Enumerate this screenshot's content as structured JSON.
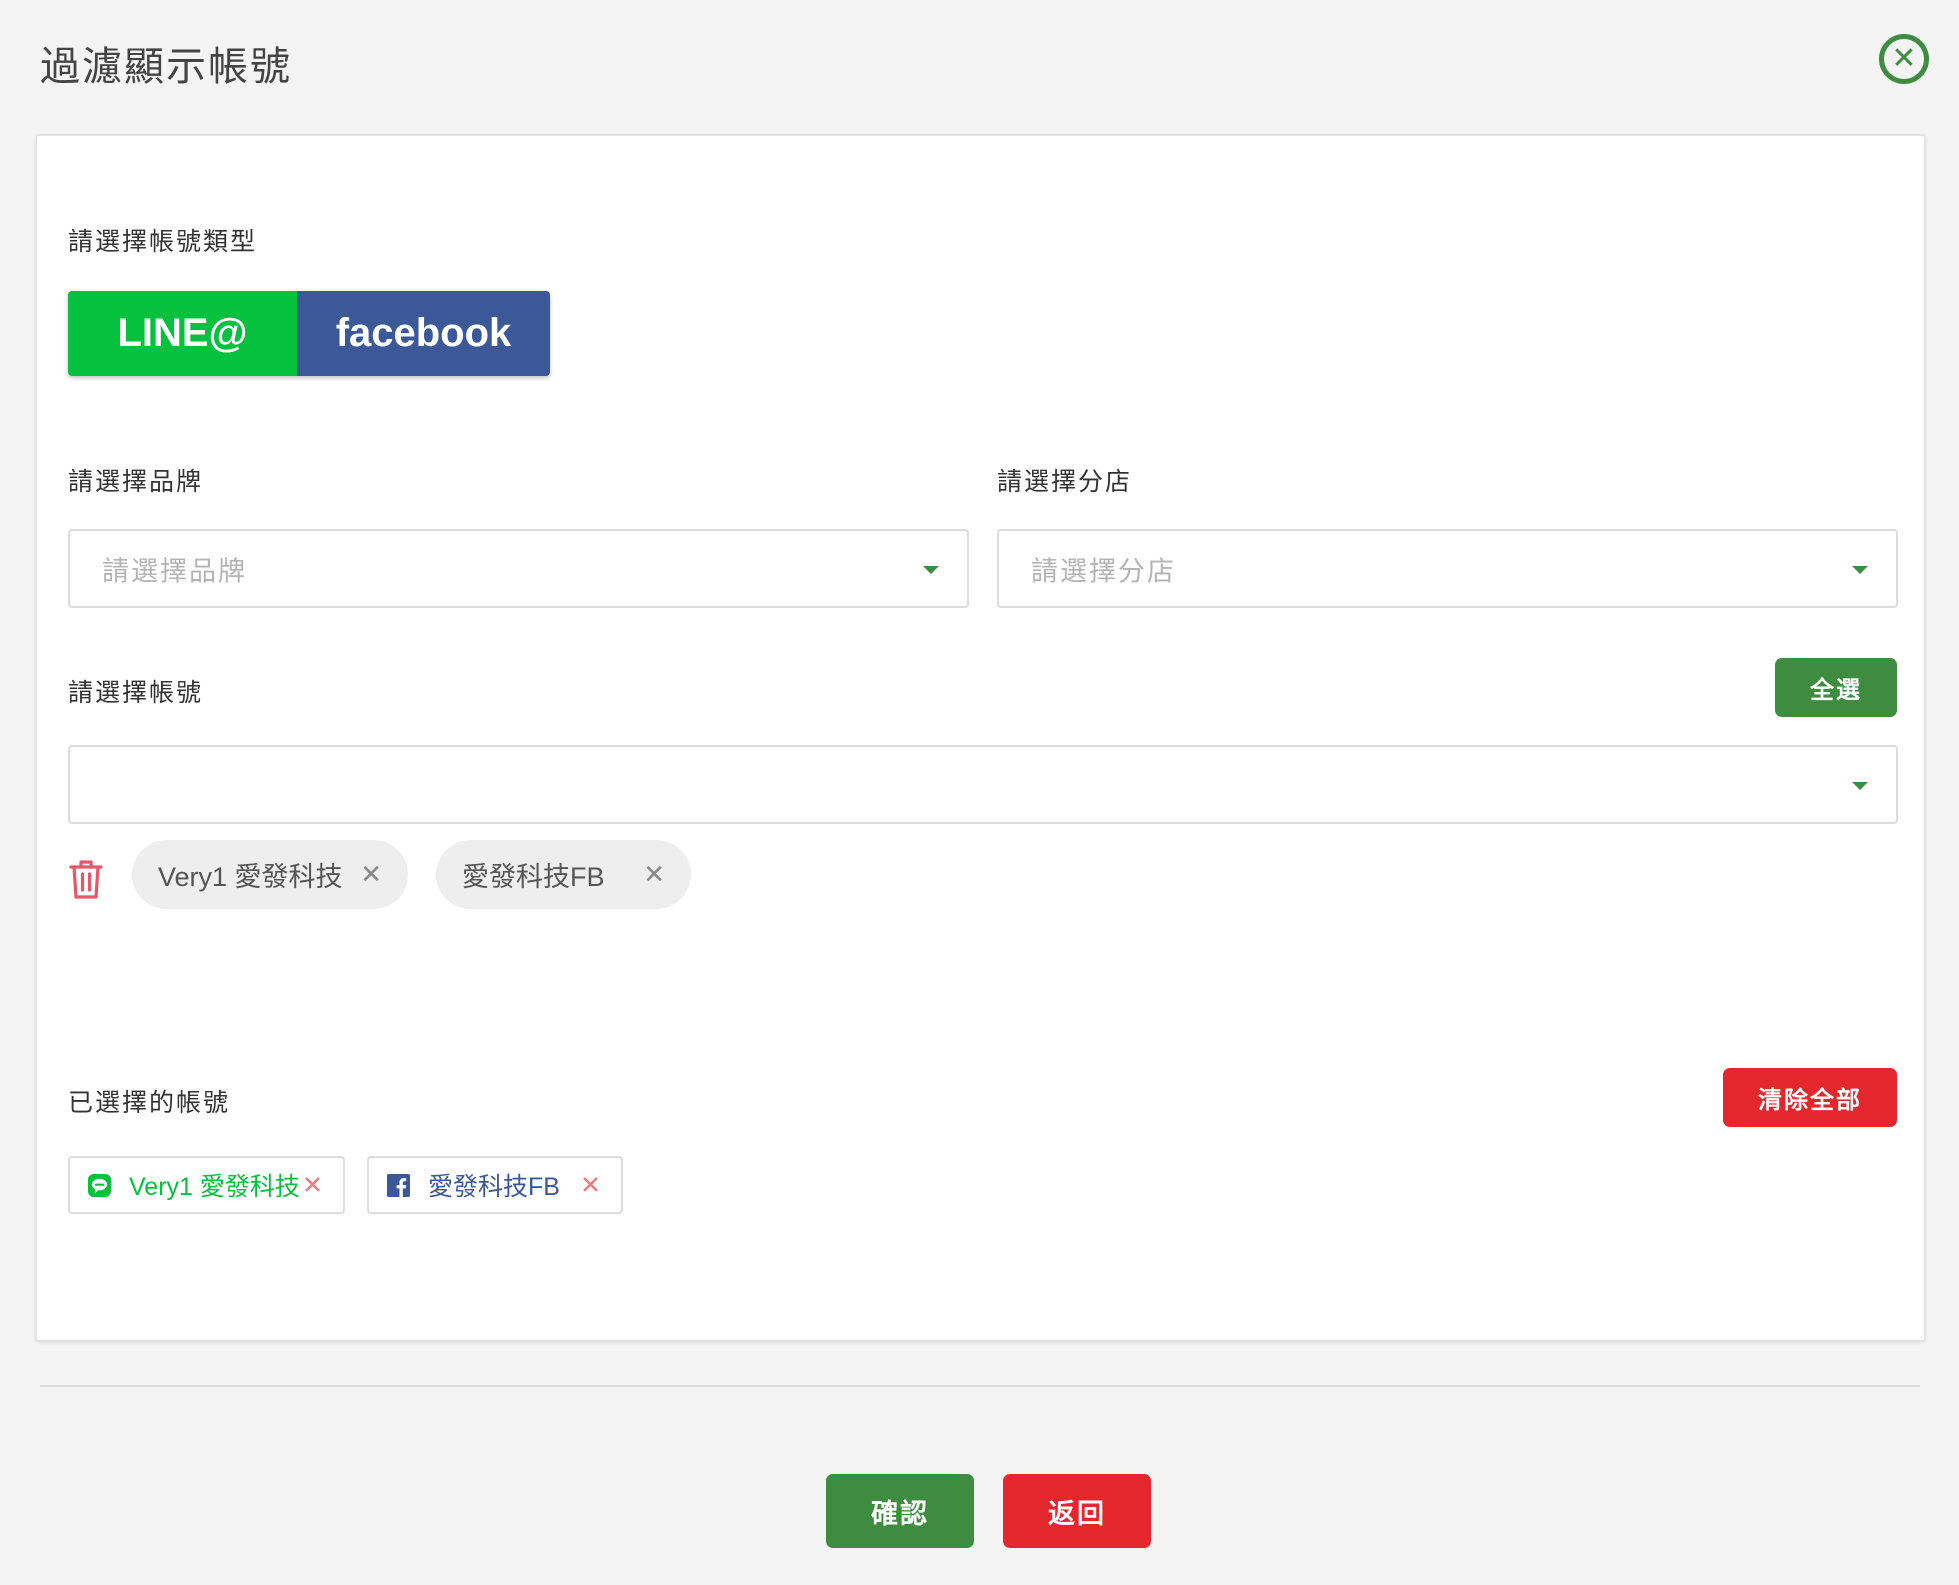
{
  "dialog": {
    "title": "過濾顯示帳號"
  },
  "account_type": {
    "label": "請選擇帳號類型",
    "line_label": "LINE@",
    "facebook_label": "facebook",
    "line_color": "#06c13e",
    "facebook_color": "#3b5998"
  },
  "brand": {
    "label": "請選擇品牌",
    "placeholder": "請選擇品牌",
    "value": ""
  },
  "branch": {
    "label": "請選擇分店",
    "placeholder": "請選擇分店",
    "value": ""
  },
  "accounts": {
    "label": "請選擇帳號",
    "select_all_label": "全選",
    "value": "",
    "chips": [
      {
        "label": "Very1 愛發科技"
      },
      {
        "label": "愛發科技FB"
      }
    ]
  },
  "selected": {
    "label": "已選擇的帳號",
    "clear_all_label": "清除全部",
    "items": [
      {
        "label": "Very1 愛發科技",
        "platform": "line",
        "icon": "line-icon",
        "color": "#06c13e"
      },
      {
        "label": "愛發科技FB",
        "platform": "facebook",
        "icon": "facebook-icon",
        "color": "#3b5998"
      }
    ]
  },
  "footer": {
    "confirm_label": "確認",
    "back_label": "返回"
  },
  "colors": {
    "accent": "#3d8c3f",
    "danger": "#e3272d",
    "trash": "#e8566a"
  }
}
